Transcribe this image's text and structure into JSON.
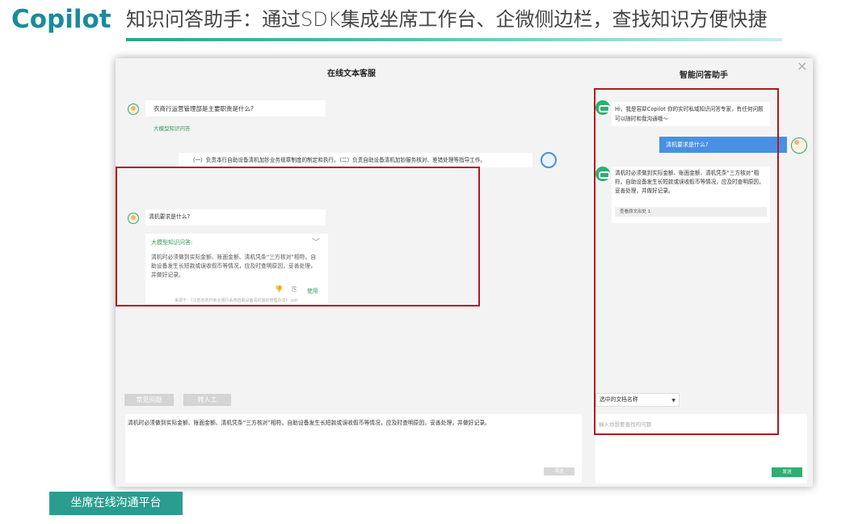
{
  "header": {
    "logo": "Copilot",
    "headline": "知识问答助手：通过SDK集成坐席工作台、企微侧边栏，查找知识方便快捷"
  },
  "window": {
    "left_title": "在线文本客服",
    "right_title": "智能问答助手",
    "close_label": "×"
  },
  "chat": {
    "q1": "农商行运营管理部是主要职责是什么?",
    "tag1": "大模型知识问答",
    "agent_reply": "（一）负责本行自助设备清机加钞业务规章制度的制定和执行。（二）负责自助设备清机加钞服务核对、差错处理等指导工作。",
    "q2": "清机要求是什么?",
    "card": {
      "title": "大模型知识问答:",
      "chevron": "﹀",
      "body": "清机时必须做到实际金额、账面金额、清机凭条“三方核对”相符。自助设备发生长短款或误收假币等情况，应及时查明原因，妥善处理，并做好记录。",
      "dislike_icon": "👎",
      "copy_icon": "⎘",
      "use_label": "使用",
      "source": "来源于：《江苏省农村商业银行系统自助设备清机加钞管理办法》.pdf"
    },
    "quick_buttons": [
      "常见问题",
      "转人工"
    ],
    "input_text": "清机时必须做到实际金额、账面金额、清机凭条“三方核对”相符。自助设备发生长短款或误收假币等情况，应及时查明原因，妥善处理，并做好记录。",
    "send_label": "发送"
  },
  "assistant": {
    "greeting": "Hi，我是容犀Copilot 你的实时私域知识问答专家，有任何问题可以随时和我沟通哦～",
    "user_q": "清机要求是什么?",
    "answer": "清机时必须做到实际金额、账面金额、清机凭条“三方核对”相符。自助设备发生长短款或误收假币等情况，应及时查明原因，妥善处理，并做好记录。",
    "source_chip": "查看原文出处 1",
    "select_value": "选中的文档名称",
    "input_placeholder": "输入你想要查找的问题",
    "send_label": "发送"
  },
  "footer_badge": "坐席在线沟通平台",
  "colors": {
    "brand": "#1b8a9a",
    "green": "#2fae71",
    "blue": "#4a90e2",
    "highlight_red": "#b3171b",
    "badge": "#2a9d8f"
  }
}
